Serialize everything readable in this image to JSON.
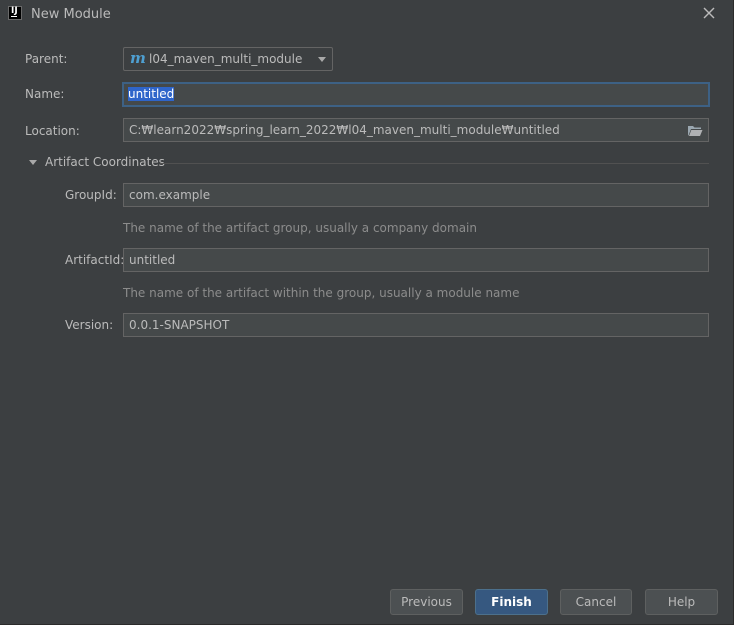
{
  "window": {
    "title": "New Module"
  },
  "form": {
    "parent": {
      "label": "Parent:",
      "value": "l04_maven_multi_module",
      "icon": "maven-m-icon"
    },
    "name": {
      "label": "Name:",
      "value": "untitled"
    },
    "location": {
      "label": "Location:",
      "value": "C:₩learn2022₩spring_learn_2022₩l04_maven_multi_module₩untitled"
    }
  },
  "artifact": {
    "section_label": "Artifact Coordinates",
    "group_id": {
      "label": "GroupId:",
      "value": "com.example",
      "hint": "The name of the artifact group, usually a company domain"
    },
    "artifact_id": {
      "label": "ArtifactId:",
      "value": "untitled",
      "hint": "The name of the artifact within the group, usually a module name"
    },
    "version": {
      "label": "Version:",
      "value": "0.0.1-SNAPSHOT"
    }
  },
  "buttons": {
    "previous": "Previous",
    "finish": "Finish",
    "cancel": "Cancel",
    "help": "Help"
  },
  "colors": {
    "background": "#3c3f41",
    "field_background": "#45494a",
    "focus_border": "#3d6185",
    "selection": "#2f65ca",
    "primary_button": "#365880",
    "maven_icon": "#4e9fd1"
  }
}
